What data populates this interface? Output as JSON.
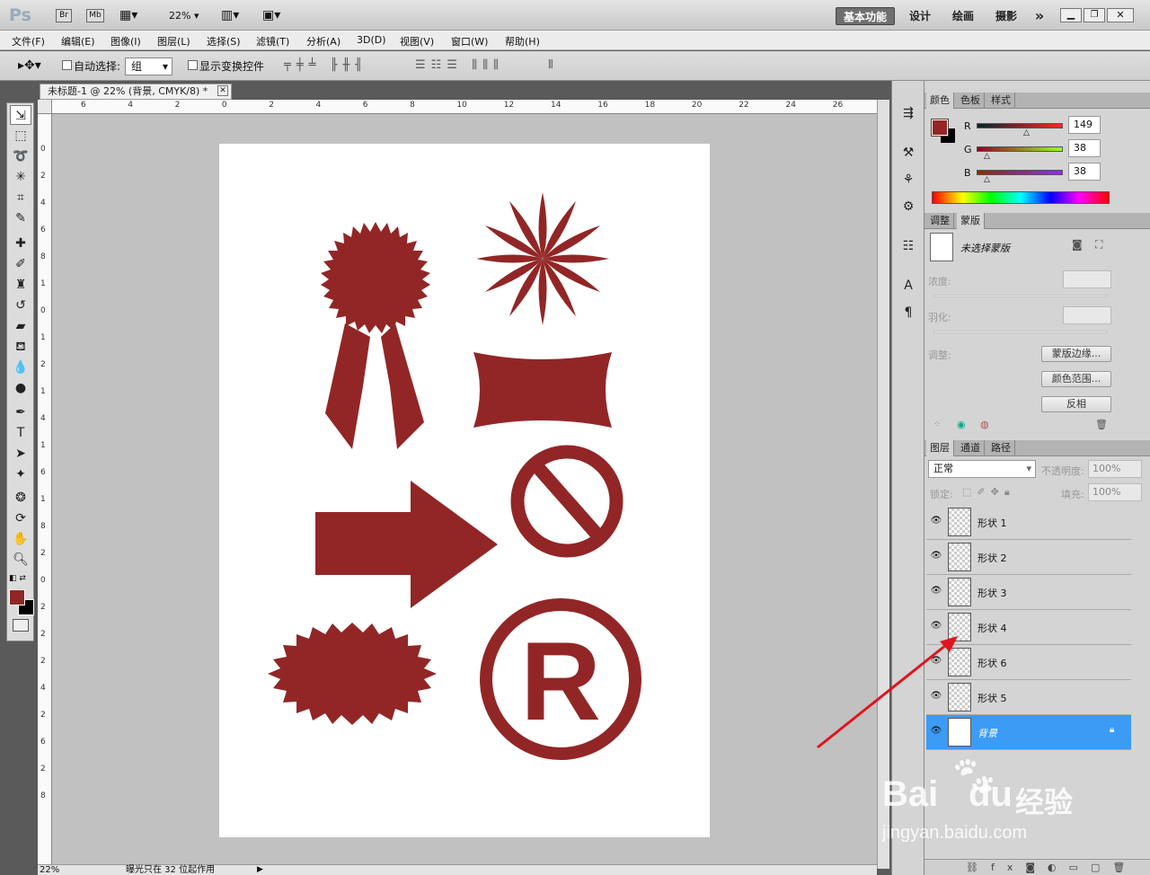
{
  "app": {
    "logo": "Ps",
    "bridge_btn": "Br",
    "minibridge_btn": "Mb",
    "zoom_select": "22%",
    "workspaces": [
      "基本功能",
      "设计",
      "绘画",
      "摄影"
    ],
    "more_workspaces": "»"
  },
  "menu": [
    "文件(F)",
    "编辑(E)",
    "图像(I)",
    "图层(L)",
    "选择(S)",
    "滤镜(T)",
    "分析(A)",
    "3D(D)",
    "视图(V)",
    "窗口(W)",
    "帮助(H)"
  ],
  "options": {
    "auto_select_label": "自动选择:",
    "auto_select_value": "组",
    "show_transform_label": "显示变换控件"
  },
  "document": {
    "tab_title": "未标题-1 @ 22% (背景, CMYK/8) *",
    "ruler_h_ticks": [
      "6",
      "4",
      "2",
      "0",
      "2",
      "4",
      "6",
      "8",
      "10",
      "12",
      "14",
      "16",
      "18",
      "20",
      "22",
      "24",
      "26"
    ],
    "ruler_v_ticks": [
      "0",
      "2",
      "4",
      "6",
      "8",
      "1",
      "0",
      "1",
      "2",
      "1",
      "4",
      "1",
      "6",
      "1",
      "8",
      "2",
      "0",
      "2",
      "2",
      "2",
      "4",
      "2",
      "6",
      "2",
      "8"
    ],
    "shape_color": "#922626"
  },
  "status": {
    "zoom": "22%",
    "message": "曝光只在 32 位起作用"
  },
  "color_panel": {
    "tabs": [
      "颜色",
      "色板",
      "样式"
    ],
    "fg_color": "#952626",
    "bg_color": "#000000",
    "channels": [
      {
        "label": "R",
        "value": "149"
      },
      {
        "label": "G",
        "value": "38"
      },
      {
        "label": "B",
        "value": "38"
      }
    ]
  },
  "masks_panel": {
    "tabs": [
      "调整",
      "蒙版"
    ],
    "no_mask": "未选择蒙版",
    "density_label": "浓度:",
    "feather_label": "羽化:",
    "refine_label": "调整:",
    "btn_edge": "蒙版边缘...",
    "btn_color_range": "颜色范围...",
    "btn_invert": "反相"
  },
  "layers_panel": {
    "tabs": [
      "图层",
      "通道",
      "路径"
    ],
    "blend_mode": "正常",
    "opacity_label": "不透明度:",
    "opacity_value": "100%",
    "lock_label": "锁定:",
    "fill_label": "填充:",
    "fill_value": "100%",
    "layers": [
      {
        "name": "形状 1",
        "selected": false
      },
      {
        "name": "形状 2",
        "selected": false
      },
      {
        "name": "形状 3",
        "selected": false
      },
      {
        "name": "形状 4",
        "selected": false
      },
      {
        "name": "形状 6",
        "selected": false
      },
      {
        "name": "形状 5",
        "selected": false
      },
      {
        "name": "背景",
        "selected": true
      }
    ]
  },
  "watermark": {
    "brand": "Bai",
    "brand2": "du",
    "brand_cn": "经验",
    "url": "jingyan.baidu.com"
  }
}
